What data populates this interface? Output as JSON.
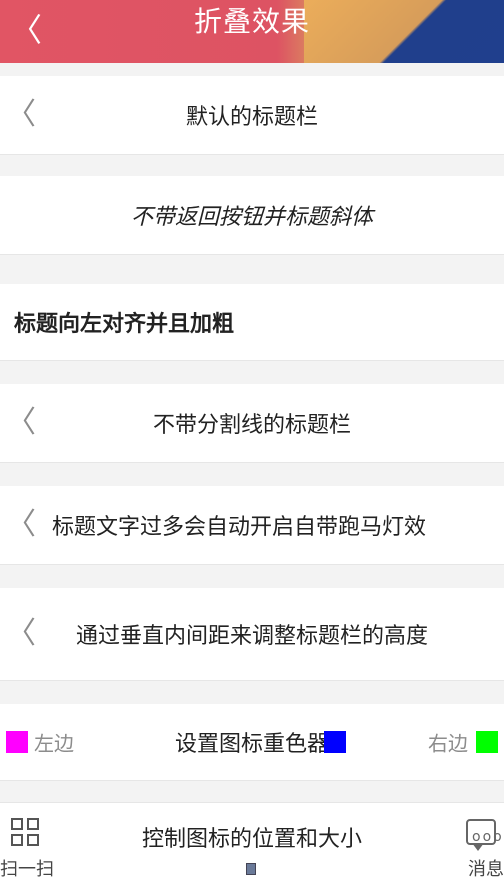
{
  "header": {
    "title": "折叠效果",
    "back_symbol": "〈",
    "accent": "#e15564",
    "accent_dark": "#1f3f8e"
  },
  "rows": [
    {
      "type": "center",
      "title": "默认的标题栏",
      "has_back": true
    },
    {
      "type": "center_italic",
      "title": "不带返回按钮并标题斜体",
      "has_back": false
    },
    {
      "type": "left_bold",
      "title": "标题向左对齐并且加粗",
      "has_back": false
    },
    {
      "type": "center",
      "title": "不带分割线的标题栏",
      "has_back": true
    },
    {
      "type": "marquee",
      "title": "标题文字过多会自动开启自带跑马灯效",
      "has_back": true
    },
    {
      "type": "center",
      "title": "通过垂直内间距来调整标题栏的高度",
      "has_back": true
    },
    {
      "type": "colors",
      "left_label": "左边",
      "center_label": "设置图标重色器",
      "right_label": "右边",
      "left_color": "#ff00ff",
      "center_color": "#0000ff",
      "right_color": "#00ff00"
    }
  ],
  "bottom_bar": {
    "left_label": "扫一扫",
    "title": "控制图标的位置和大小",
    "right_label": "消息",
    "dots": "ooo"
  }
}
